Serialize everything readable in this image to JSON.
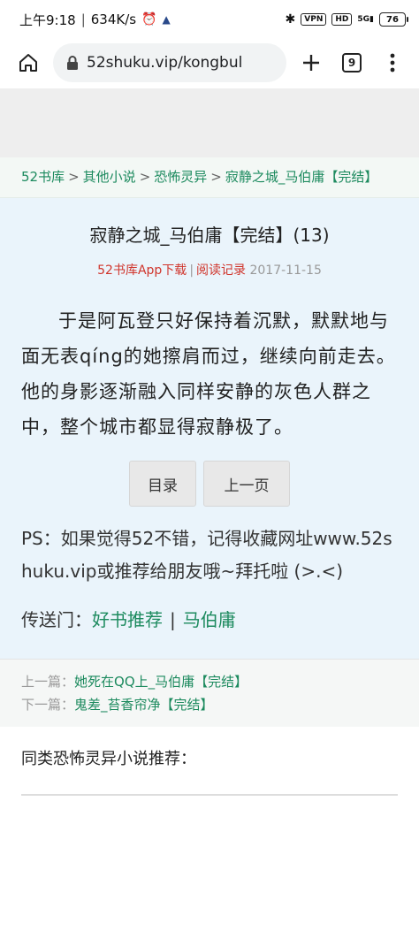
{
  "status": {
    "time": "上午9:18",
    "speed": "634K/s",
    "vpn": "VPN",
    "volte": "HD",
    "signal": "5G",
    "battery": "76"
  },
  "browser": {
    "url": "52shuku.vip/kongbul",
    "tab_count": "9"
  },
  "breadcrumb": {
    "items": [
      "52书库",
      "其他小说",
      "恐怖灵异",
      "寂静之城_马伯庸【完结】"
    ],
    "sep": ">"
  },
  "article": {
    "title": "寂静之城_马伯庸【完结】(13)",
    "app_download": "52书库App下载",
    "reading_log": "阅读记录",
    "date": "2017-11-15",
    "content": "于是阿瓦登只好保持着沉默，默默地与面无表qíng的她擦肩而过，继续向前走去。他的身影逐渐融入同样安静的灰色人群之中，整个城市都显得寂静极了。"
  },
  "buttons": {
    "toc": "目录",
    "prev_page": "上一页"
  },
  "ps_text": "PS：如果觉得52不错，记得收藏网址www.52shuku.vip或推荐给朋友哦~拜托啦 (>.<)",
  "portal": {
    "label": "传送门：",
    "link1": "好书推荐",
    "pipe": "|",
    "link2": "马伯庸"
  },
  "prevnext": {
    "prev_label": "上一篇：",
    "prev_title": "她死在QQ上_马伯庸【完结】",
    "next_label": "下一篇：",
    "next_title": "鬼差_苔香帘净【完结】"
  },
  "similar_heading": "同类恐怖灵异小说推荐："
}
